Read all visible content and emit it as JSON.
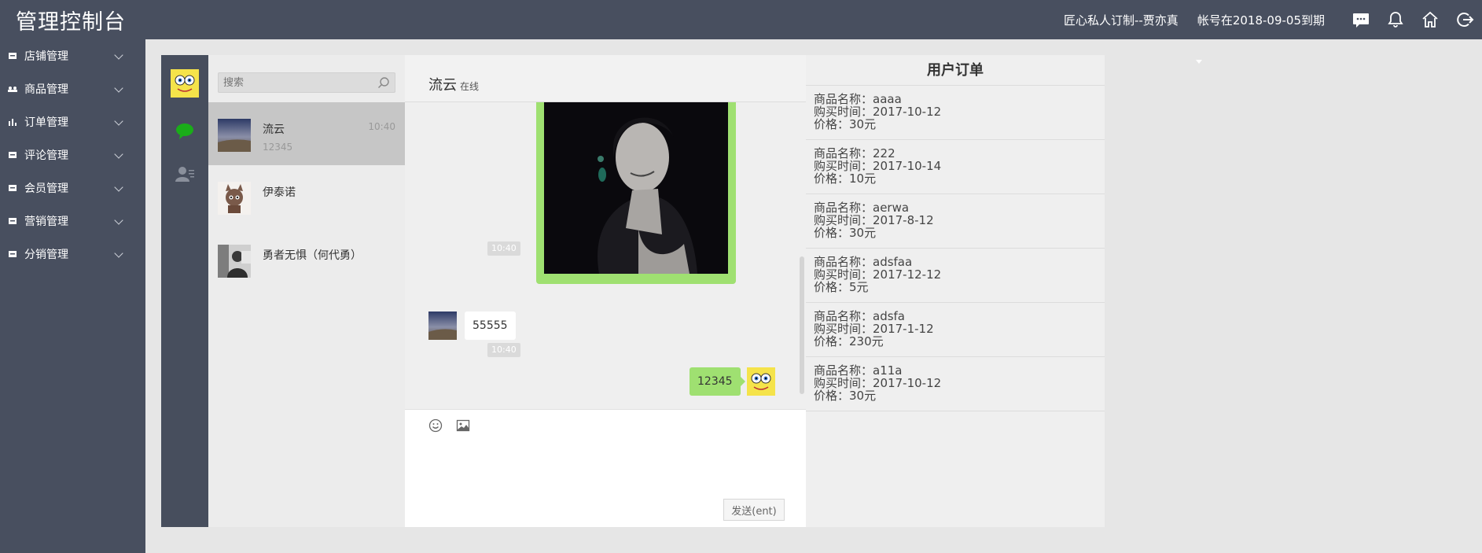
{
  "app": {
    "title": "管理控制台"
  },
  "header": {
    "shop_name": "匠心私人订制--贾亦真",
    "expire_text": "帐号在2018-09-05到期"
  },
  "sidebar": {
    "items": [
      {
        "label": "店铺管理",
        "icon": "shop-icon"
      },
      {
        "label": "商品管理",
        "icon": "goods-icon"
      },
      {
        "label": "订单管理",
        "icon": "chart-icon"
      },
      {
        "label": "评论管理",
        "icon": "comment-icon"
      },
      {
        "label": "会员管理",
        "icon": "member-icon"
      },
      {
        "label": "营销管理",
        "icon": "marketing-icon"
      },
      {
        "label": "分销管理",
        "icon": "distribution-icon"
      }
    ]
  },
  "search": {
    "placeholder": "搜索"
  },
  "conversations": [
    {
      "name": "流云",
      "last_message": "12345",
      "time": "10:40"
    },
    {
      "name": "伊泰诺",
      "last_message": "",
      "time": ""
    },
    {
      "name": "勇者无惧（何代勇）",
      "last_message": "",
      "time": ""
    }
  ],
  "chat": {
    "contact_name": "流云",
    "status": "在线",
    "messages": [
      {
        "type": "image",
        "from": "me"
      },
      {
        "type": "timestamp",
        "text": "10:40"
      },
      {
        "type": "text",
        "from": "them",
        "text": "55555"
      },
      {
        "type": "timestamp",
        "text": "10:40"
      },
      {
        "type": "text",
        "from": "me",
        "text": "12345"
      }
    ],
    "send_label": "发送(ent)"
  },
  "orders": {
    "title": "用户订单",
    "items": [
      {
        "name": "商品名称：aaaa",
        "time": "购买时间：2017-10-12",
        "price": "价格：30元"
      },
      {
        "name": "商品名称：222",
        "time": "购买时间：2017-10-14",
        "price": "价格：10元"
      },
      {
        "name": "商品名称：aerwa",
        "time": "购买时间：2017-8-12",
        "price": "价格：30元"
      },
      {
        "name": "商品名称：adsfaa",
        "time": "购买时间：2017-12-12",
        "price": "价格：5元"
      },
      {
        "name": "商品名称：adsfa",
        "time": "购买时间：2017-1-12",
        "price": "价格：230元"
      },
      {
        "name": "商品名称：a11a",
        "time": "购买时间：2017-10-12",
        "price": "价格：30元"
      }
    ]
  },
  "colors": {
    "topbar": "#484f5f",
    "bubble_out": "#9fe071",
    "online_icon": "#1aad19"
  }
}
